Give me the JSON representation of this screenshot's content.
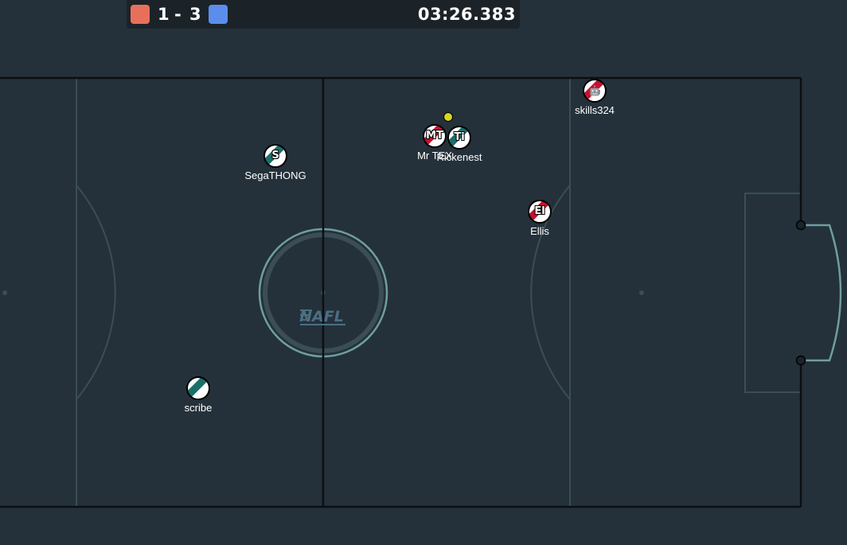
{
  "scoreboard": {
    "red_score": "1",
    "separator": "-",
    "blue_score": "3",
    "timer": "03:26.383",
    "red_color": "#e8705a",
    "blue_color": "#5b8ded"
  },
  "pitch": {
    "background": "#24313a",
    "field_line_color": "#3b4d55",
    "boundary_color": "#0b0f12",
    "goal_post_color": "#6f9ea0",
    "center_logo": "NAFL"
  },
  "ball": {
    "color": "#d8d524"
  },
  "players": [
    {
      "name": "SegaTHONG",
      "avatar": "S",
      "team": "blue",
      "avatar_icon": "striped-disc"
    },
    {
      "name": "Mr TEX",
      "avatar": "MT",
      "team": "red",
      "avatar_icon": "striped-disc"
    },
    {
      "name": "Rickenest",
      "avatar": "Ti",
      "team": "blue",
      "avatar_icon": "striped-disc"
    },
    {
      "name": "skills324",
      "avatar": "🤖",
      "team": "red",
      "avatar_icon": "robot-icon"
    },
    {
      "name": "Ellis",
      "avatar": "El",
      "team": "red",
      "avatar_icon": "striped-disc"
    },
    {
      "name": "scribe",
      "avatar": "",
      "team": "blue",
      "avatar_icon": "striped-disc"
    }
  ]
}
